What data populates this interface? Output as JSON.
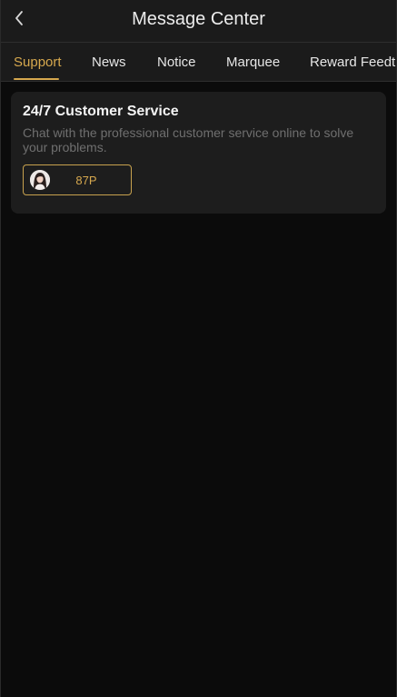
{
  "header": {
    "title": "Message Center",
    "back_icon": "chevron-left-icon"
  },
  "tabs": [
    {
      "label": "Support",
      "active": true
    },
    {
      "label": "News",
      "active": false
    },
    {
      "label": "Notice",
      "active": false
    },
    {
      "label": "Marquee",
      "active": false
    },
    {
      "label": "Reward Feedt",
      "active": false
    }
  ],
  "support_card": {
    "title": "24/7 Customer Service",
    "description": "Chat with the professional customer service online to solve your problems.",
    "agent_label": "87P",
    "avatar_icon": "agent-avatar"
  },
  "colors": {
    "accent": "#d6a84e",
    "background": "#0b0b0b",
    "surface": "#1b1b1b",
    "card": "#1d1d1d",
    "muted_text": "#6f6f6f"
  }
}
